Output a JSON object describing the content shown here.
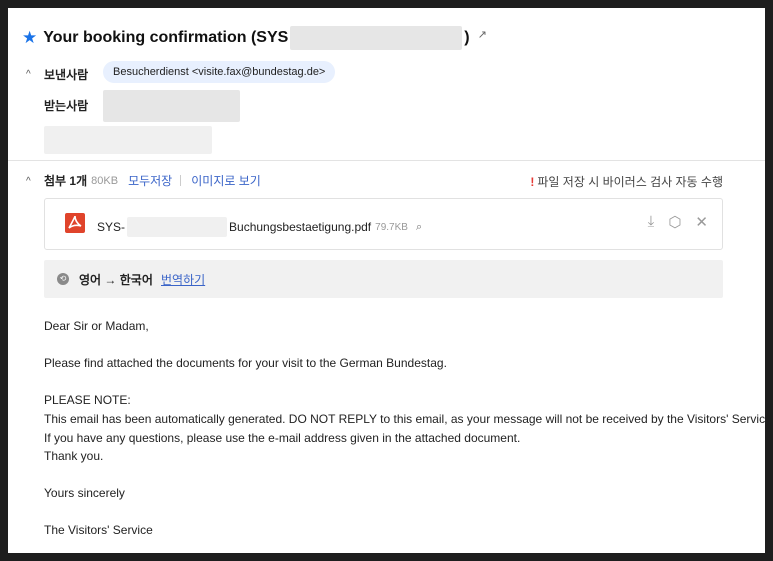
{
  "email": {
    "subject_prefix": "Your booking confirmation (SYS",
    "subject_suffix": ")",
    "from_label": "보낸사람",
    "from_value": "Besucherdienst <visite.fax@bundestag.de>",
    "to_label": "받는사람"
  },
  "attachments": {
    "title": "첨부 1개",
    "total_size": "80KB",
    "save_all": "모두저장",
    "view_as_image": "이미지로 보기",
    "virus_notice": "파일 저장 시 바이러스 검사 자동 수행",
    "file": {
      "name_prefix": "SYS-",
      "name_suffix": "Buchungsbestaetigung.pdf",
      "size": "79.7KB"
    }
  },
  "translate": {
    "languages": "영어 → 한국어",
    "action": "번역하기"
  },
  "body": {
    "greeting": "Dear Sir or Madam,",
    "line1": "Please find attached the documents for your visit to the German Bundestag.",
    "note_title": "PLEASE NOTE:",
    "note1": "This email has been automatically generated. DO NOT REPLY to this email, as your message will not be received by the Visitors' Service.",
    "note2": "If you have any questions, please use the e-mail address given in the attached document.",
    "thanks": "Thank you.",
    "closing": "Yours sincerely",
    "signature": "The Visitors' Service"
  },
  "colors": {
    "accent": "#1a73e8",
    "link": "#3a64c8",
    "warning": "#e53935",
    "pdf": "#e0442b"
  }
}
